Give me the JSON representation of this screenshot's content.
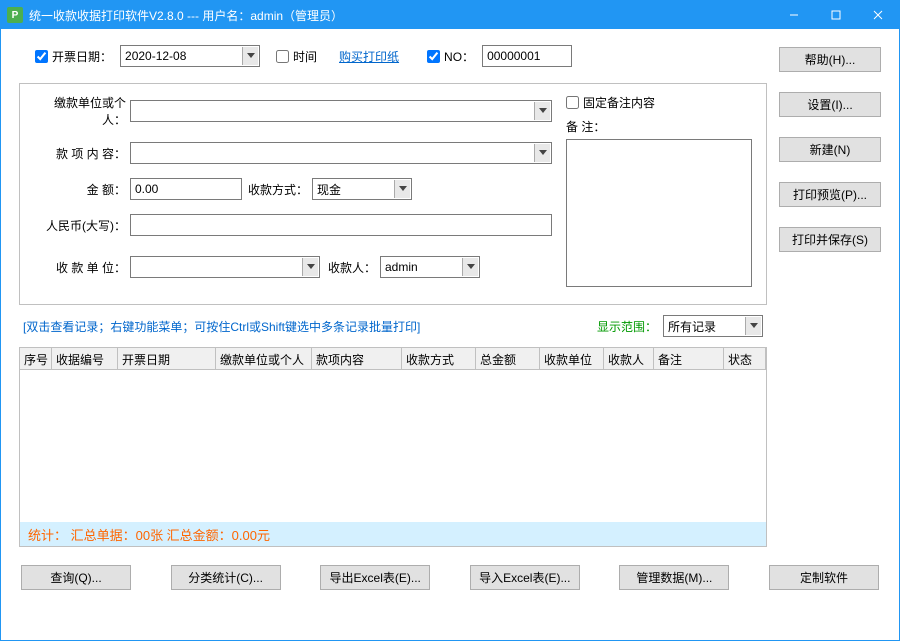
{
  "titlebar": {
    "icon_letter": "P",
    "text": "统一收款收据打印软件V2.8.0 --- 用户名：admin（管理员）"
  },
  "row1": {
    "invoice_date_label": "开票日期：",
    "invoice_date_value": "2020-12-08",
    "time_label": "时间",
    "buy_paper_link": "购买打印纸",
    "no_label": "NO：",
    "no_value": "00000001"
  },
  "form": {
    "payer_label": "缴款单位或个人：",
    "content_label": "款 项 内 容：",
    "amount_label": "金        额：",
    "amount_value": "0.00",
    "pay_method_label": "收款方式：",
    "pay_method_value": "现金",
    "rmb_label": "人民币(大写)：",
    "payee_unit_label": "收 款 单 位：",
    "payee_label": "收款人：",
    "payee_value": "admin",
    "fixed_remark_label": "固定备注内容",
    "remark_label": "备 注："
  },
  "side_buttons": {
    "help": "帮助(H)...",
    "settings": "设置(I)...",
    "new": "新建(N)",
    "preview": "打印预览(P)...",
    "save": "打印并保存(S)"
  },
  "hint_row": {
    "hint": "[双击查看记录；右键功能菜单；可按住Ctrl或Shift键选中多条记录批量打印]",
    "range_label": "显示范围：",
    "range_value": "所有记录"
  },
  "grid": {
    "headers": [
      "序号",
      "收据编号",
      "开票日期",
      "缴款单位或个人",
      "款项内容",
      "收款方式",
      "总金额",
      "收款单位",
      "收款人",
      "备注",
      "状态"
    ],
    "widths": [
      32,
      66,
      98,
      96,
      90,
      74,
      64,
      64,
      50,
      70,
      42
    ]
  },
  "totals": {
    "text": "统计：  汇总单据：00张      汇总金额：0.00元"
  },
  "bottom": {
    "query": "查询(Q)...",
    "stats": "分类统计(C)...",
    "export": "导出Excel表(E)...",
    "import": "导入Excel表(E)...",
    "manage": "管理数据(M)...",
    "custom": "定制软件"
  }
}
